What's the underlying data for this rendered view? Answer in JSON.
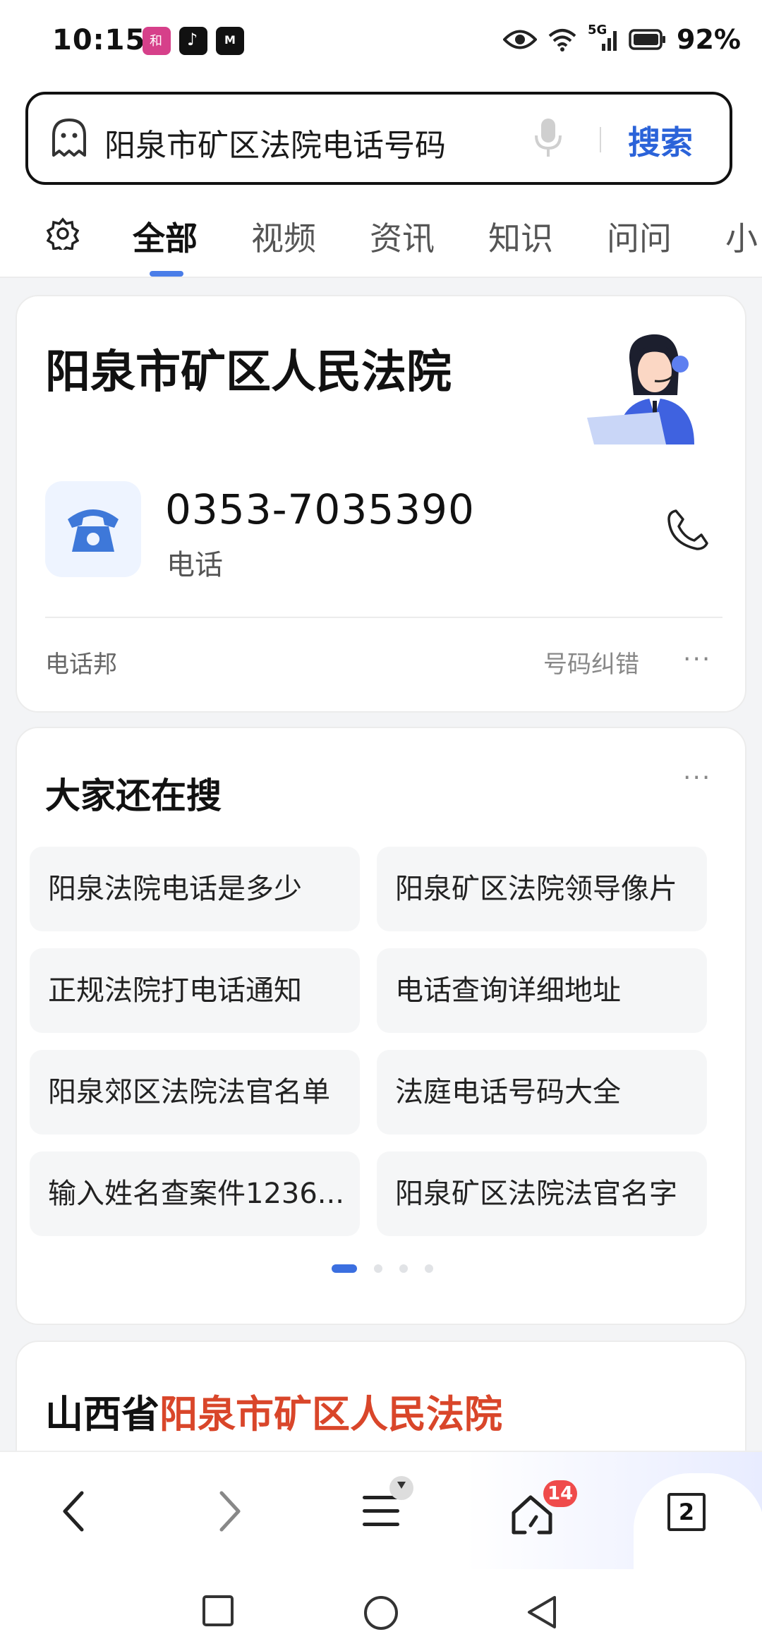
{
  "status_bar": {
    "time": "10:15",
    "network": "5G",
    "battery": "92%",
    "icons": [
      "app-notification-icon",
      "tiktok-icon",
      "moji-weather-icon",
      "eye-icon",
      "wifi-icon",
      "signal-icon",
      "battery-icon"
    ]
  },
  "search": {
    "query": "阳泉市矿区法院电话号码",
    "button": "搜索",
    "icons": [
      "ghost-icon",
      "microphone-icon"
    ]
  },
  "tabs": {
    "items": [
      "全部",
      "视频",
      "资讯",
      "知识",
      "问问",
      "小"
    ],
    "active": "全部"
  },
  "phone_card": {
    "title": "阳泉市矿区人民法院",
    "number": "0353-7035390",
    "number_label": "电话",
    "source": "电话邦",
    "correct": "号码纠错",
    "more": "···"
  },
  "related": {
    "title": "大家还在搜",
    "more": "···",
    "items": [
      "阳泉法院电话是多少",
      "阳泉矿区法院领导像片",
      "正规法院打电话通知",
      "电话查询详细地址",
      "阳泉郊区法院法官名单",
      "法庭电话号码大全",
      "输入姓名查案件1236...",
      "阳泉矿区法院法官名字"
    ],
    "page_index": 1,
    "page_count": 4
  },
  "result": {
    "title_prefix": "山西省",
    "title_highlight": "阳泉市矿区人民法院"
  },
  "bottom_bar": {
    "home_badge": "14",
    "tab_count": "2"
  },
  "colors": {
    "accent": "#2b63d9",
    "highlight": "#d9462a",
    "badge": "#ef4b4b"
  }
}
